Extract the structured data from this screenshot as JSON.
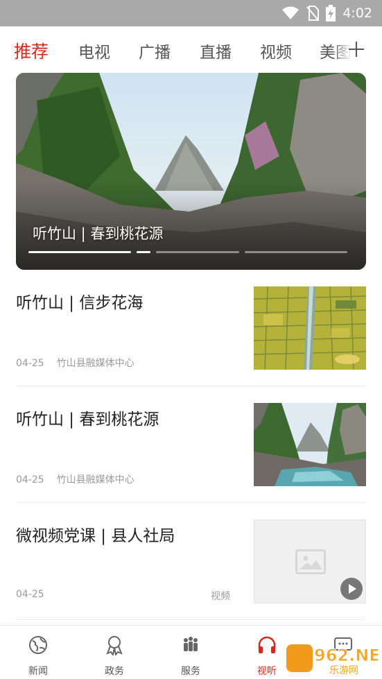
{
  "status_bar": {
    "time": "4:02",
    "icons": [
      "wifi-icon",
      "no-sim-icon",
      "battery-charging-icon"
    ]
  },
  "tabs": [
    {
      "label": "推荐",
      "active": true
    },
    {
      "label": "电视",
      "active": false
    },
    {
      "label": "广播",
      "active": false
    },
    {
      "label": "直播",
      "active": false
    },
    {
      "label": "视频",
      "active": false
    },
    {
      "label": "美图",
      "active": false
    }
  ],
  "add_channel_icon": "plus-icon",
  "banner": {
    "title": "听竹山 | 春到桃花源",
    "slide_count": 4,
    "active_slide": 1
  },
  "news": [
    {
      "title": "听竹山 | 信步花海",
      "date": "04-25",
      "source": "竹山县融媒体中心",
      "tag": "",
      "thumb": "rapeseed-field-aerial"
    },
    {
      "title": "听竹山 | 春到桃花源",
      "date": "04-25",
      "source": "竹山县融媒体中心",
      "tag": "",
      "thumb": "mountain-stream"
    },
    {
      "title": "微视频党课 | 县人社局",
      "date": "04-25",
      "source": "",
      "tag": "视频",
      "thumb": "image-placeholder"
    }
  ],
  "bottom_nav": [
    {
      "label": "新闻",
      "icon": "globe-icon",
      "active": false
    },
    {
      "label": "政务",
      "icon": "ribbon-badge-icon",
      "active": false
    },
    {
      "label": "服务",
      "icon": "people-icon",
      "active": false
    },
    {
      "label": "视听",
      "icon": "headphones-icon",
      "active": true
    },
    {
      "label": "",
      "icon": "chat-icon",
      "active": false
    }
  ],
  "watermark": {
    "text": "962.NET",
    "subtext": "乐游网"
  },
  "colors": {
    "accent": "#d8271c",
    "status_bar": "#a9a9a9"
  }
}
